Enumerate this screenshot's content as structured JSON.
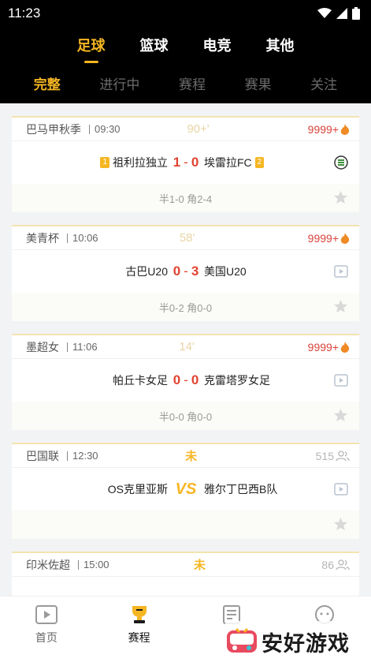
{
  "status": {
    "time": "11:23"
  },
  "sports_tabs": [
    {
      "label": "足球",
      "active": true
    },
    {
      "label": "篮球",
      "active": false
    },
    {
      "label": "电竞",
      "active": false
    },
    {
      "label": "其他",
      "active": false
    }
  ],
  "sub_tabs": [
    {
      "label": "完整",
      "active": true
    },
    {
      "label": "进行中",
      "active": false
    },
    {
      "label": "赛程",
      "active": false
    },
    {
      "label": "赛果",
      "active": false
    },
    {
      "label": "关注",
      "active": false
    }
  ],
  "matches": [
    {
      "league": "巴马甲秋季",
      "time": "09:30",
      "minute": "90+'",
      "heat": "9999+",
      "home": "祖利拉独立",
      "home_rank": "1",
      "home_score": "1",
      "away_score": "0",
      "away": "埃雷拉FC",
      "away_rank": "2",
      "stats": "半1-0 角2-4"
    },
    {
      "league": "美青杯",
      "time": "10:06",
      "minute": "58'",
      "heat": "9999+",
      "home": "古巴U20",
      "home_score": "0",
      "away_score": "3",
      "away": "美国U20",
      "stats": "半0-2 角0-0"
    },
    {
      "league": "墨超女",
      "time": "11:06",
      "minute": "14'",
      "heat": "9999+",
      "home": "帕丘卡女足",
      "home_score": "0",
      "away_score": "0",
      "away": "克雷塔罗女足",
      "stats": "半0-0 角0-0"
    },
    {
      "league": "巴国联",
      "time": "12:30",
      "minute": "未",
      "heat": "515",
      "home": "OS克里亚斯",
      "vs": "VS",
      "away": "雅尔丁巴西B队",
      "stats": ""
    },
    {
      "league": "印米佐超",
      "time": "15:00",
      "minute": "未",
      "heat": "86"
    }
  ],
  "bottom_nav": [
    {
      "label": "首页",
      "icon": "play-icon"
    },
    {
      "label": "赛程",
      "icon": "trophy-icon",
      "active": true
    },
    {
      "label": "",
      "icon": "news-icon"
    },
    {
      "label": "",
      "icon": "chat-icon"
    }
  ],
  "watermark": {
    "text": "安好游戏"
  },
  "colors": {
    "accent": "#f5b623",
    "score": "#e2422f",
    "heat": "#d9433a"
  }
}
